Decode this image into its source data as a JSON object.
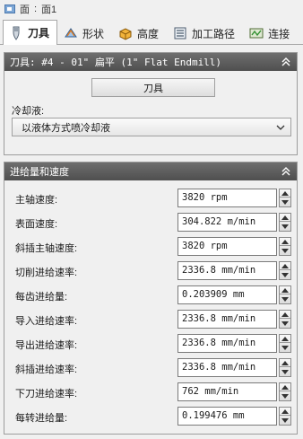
{
  "breadcrumb": {
    "part1": "面",
    "sep": ":",
    "part2": "面1"
  },
  "tabs": [
    {
      "label": "刀具",
      "active": true
    },
    {
      "label": "形状",
      "active": false
    },
    {
      "label": "高度",
      "active": false
    },
    {
      "label": "加工路径",
      "active": false
    },
    {
      "label": "连接",
      "active": false
    }
  ],
  "tool_panel": {
    "header": "刀具: #4 - 01\" 扁平 (1\" Flat Endmill)",
    "tool_button": "刀具",
    "coolant_label": "冷却液:",
    "coolant_value": "以液体方式喷冷却液"
  },
  "feed_panel": {
    "header": "进给量和速度",
    "rows": [
      {
        "label": "主轴速度:",
        "value": "3820 rpm"
      },
      {
        "label": "表面速度:",
        "value": "304.822 m/min"
      },
      {
        "label": "斜插主轴速度:",
        "value": "3820 rpm"
      },
      {
        "label": "切削进给速率:",
        "value": "2336.8 mm/min"
      },
      {
        "label": "每齿进给量:",
        "value": "0.203909 mm"
      },
      {
        "label": "导入进给速率:",
        "value": "2336.8 mm/min"
      },
      {
        "label": "导出进给速率:",
        "value": "2336.8 mm/min"
      },
      {
        "label": "斜插进给速率:",
        "value": "2336.8 mm/min"
      },
      {
        "label": "下刀进给速率:",
        "value": "762 mm/min"
      },
      {
        "label": "每转进给量:",
        "value": "0.199476 mm"
      }
    ]
  },
  "colors": {
    "panel_header": "#555555",
    "tab_border": "#a8a8a8",
    "background": "#f0f0f0"
  }
}
